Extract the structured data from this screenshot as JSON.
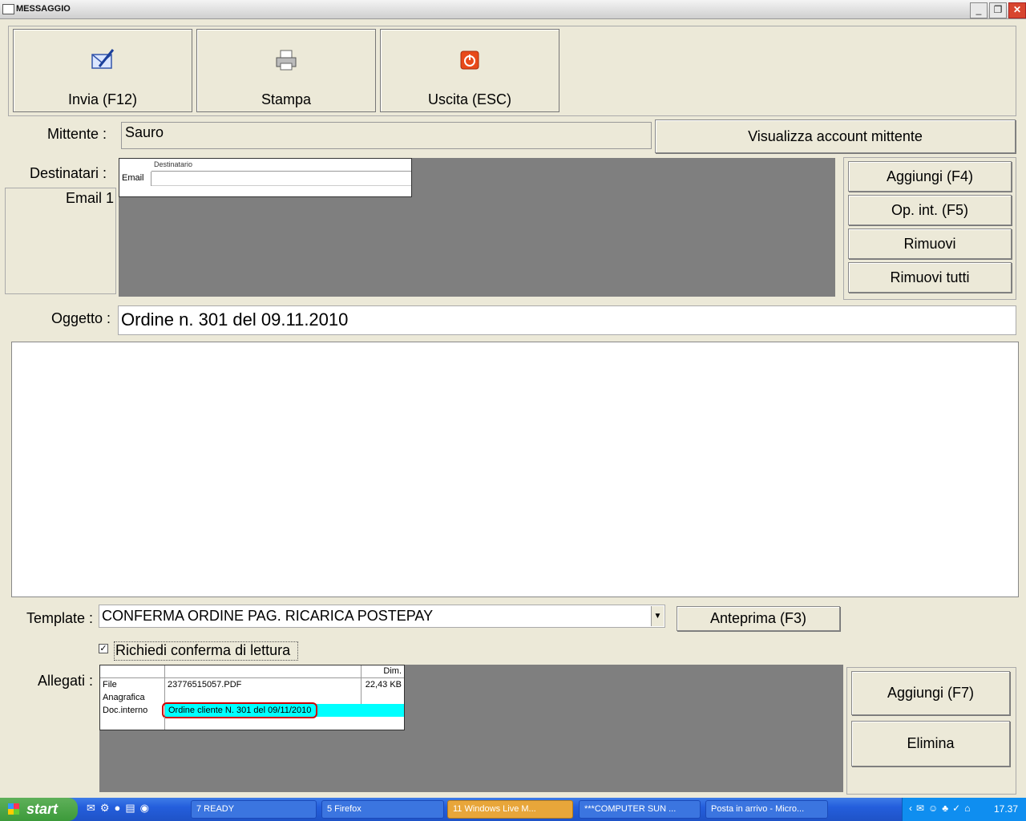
{
  "window": {
    "title": "MESSAGGIO"
  },
  "toolbar": {
    "send_label": "Invia (F12)",
    "print_label": "Stampa",
    "exit_label": "Uscita (ESC)"
  },
  "sender": {
    "label": "Mittente :",
    "value": "Sauro",
    "view_account_label": "Visualizza account mittente"
  },
  "recipients": {
    "label": "Destinatari :",
    "list": [
      "Email 1"
    ],
    "grid_header": "Destinatario",
    "grid_row_label": "Email",
    "add_label": "Aggiungi (F4)",
    "internal_label": "Op. int. (F5)",
    "remove_label": "Rimuovi",
    "remove_all_label": "Rimuovi tutti"
  },
  "subject": {
    "label": "Oggetto :",
    "value": "Ordine n. 301 del 09.11.2010"
  },
  "body": {
    "value": ""
  },
  "template": {
    "label": "Template :",
    "value": "CONFERMA ORDINE PAG. RICARICA POSTEPAY",
    "preview_label": "Anteprima (F3)"
  },
  "read_receipt": {
    "label": "Richiedi conferma di lettura",
    "checked": true
  },
  "attachments": {
    "label": "Allegati :",
    "col_dim": "Dim.",
    "rows": [
      {
        "type": "File",
        "name": "23776515057.PDF",
        "size": "22,43 KB"
      },
      {
        "type": "Anagrafica",
        "name": "",
        "size": ""
      },
      {
        "type": "Doc.interno",
        "name": "Ordine cliente N. 301 del 09/11/2010",
        "size": ""
      }
    ],
    "add_label": "Aggiungi (F7)",
    "delete_label": "Elimina"
  },
  "taskbar": {
    "start_label": "start",
    "tasks": [
      {
        "label": "7 READY"
      },
      {
        "label": "5 Firefox"
      },
      {
        "label": "11 Windows Live M..."
      },
      {
        "label": "***COMPUTER SUN ..."
      },
      {
        "label": "Posta in arrivo - Micro..."
      }
    ],
    "clock": "17.37"
  },
  "colors": {
    "highlight_row": "#00ffff",
    "highlight_border": "#d00000",
    "panel_gray": "#7f7f7f"
  }
}
